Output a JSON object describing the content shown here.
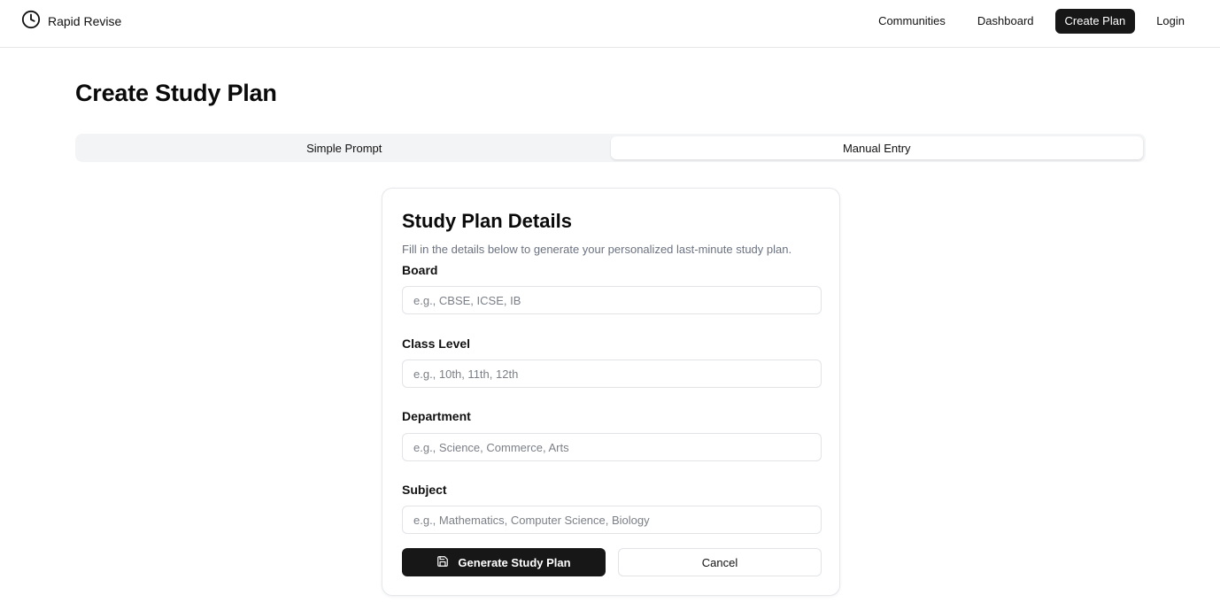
{
  "brand": {
    "name": "Rapid Revise",
    "icon": "clock-icon"
  },
  "nav": {
    "items": [
      {
        "label": "Communities",
        "active": false
      },
      {
        "label": "Dashboard",
        "active": false
      },
      {
        "label": "Create Plan",
        "active": true
      },
      {
        "label": "Login",
        "active": false
      }
    ]
  },
  "page": {
    "title": "Create Study Plan"
  },
  "tabs": [
    {
      "label": "Simple Prompt",
      "active": false
    },
    {
      "label": "Manual Entry",
      "active": true
    }
  ],
  "card": {
    "title": "Study Plan Details",
    "description": "Fill in the details below to generate your personalized last-minute study plan.",
    "fields": [
      {
        "label": "Board",
        "placeholder": "e.g., CBSE, ICSE, IB",
        "value": ""
      },
      {
        "label": "Class Level",
        "placeholder": "e.g., 10th, 11th, 12th",
        "value": ""
      },
      {
        "label": "Department",
        "placeholder": "e.g., Science, Commerce, Arts",
        "value": ""
      },
      {
        "label": "Subject",
        "placeholder": "e.g., Mathematics, Computer Science, Biology",
        "value": ""
      }
    ],
    "primary_button": {
      "label": "Generate Study Plan",
      "icon": "save-icon"
    },
    "secondary_button": {
      "label": "Cancel"
    }
  },
  "colors": {
    "primary": "#171717",
    "muted_text": "#6b7280",
    "border": "#e5e7eb",
    "tab_track": "#f3f4f6"
  }
}
